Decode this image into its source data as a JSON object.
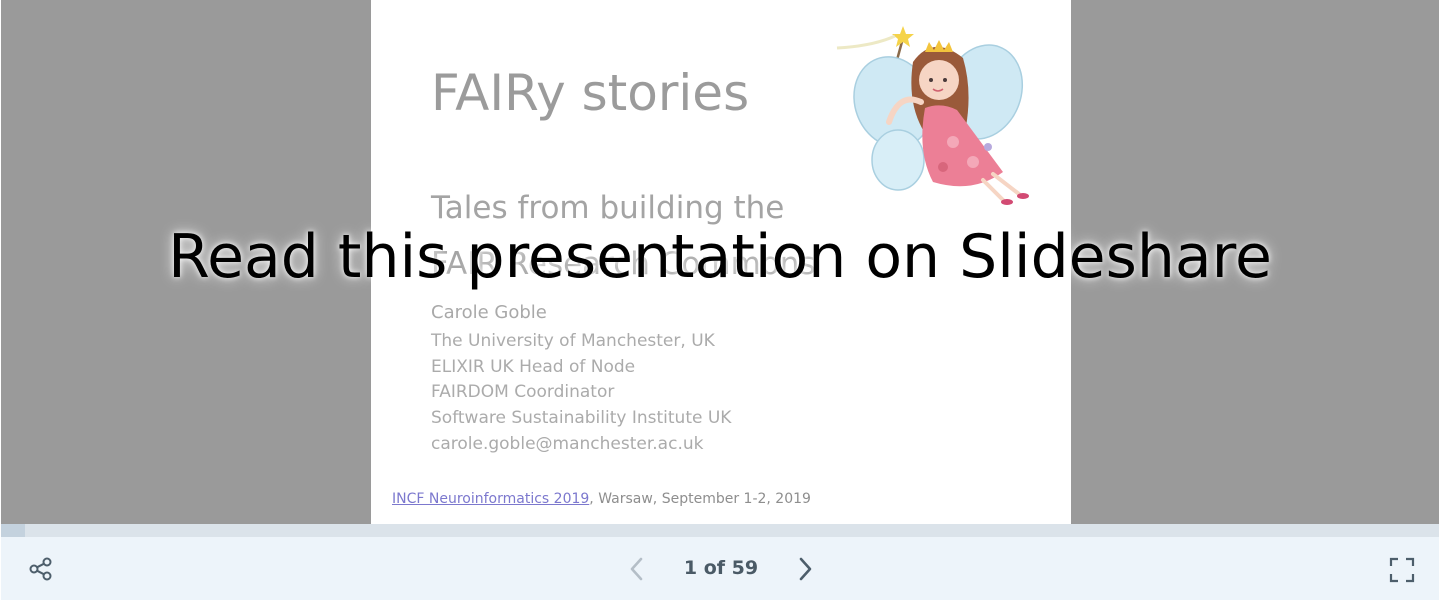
{
  "slide": {
    "title": "FAIRy stories",
    "subtitle_lines": [
      "Tales from building the",
      "FAIR Research Commons"
    ],
    "author": "Carole Goble",
    "affiliations": [
      "The University of Manchester, UK",
      "ELIXIR UK Head of Node",
      "FAIRDOM Coordinator",
      "Software Sustainability Institute UK",
      "carole.goble@manchester.ac.uk"
    ],
    "footer_link": "INCF Neuroinformatics 2019",
    "footer_rest": ", Warsaw, September 1-2, 2019",
    "image": "fairy-illustration"
  },
  "overlay": {
    "text": "Read this presentation on Slideshare"
  },
  "toolbar": {
    "share_icon": "share-icon",
    "prev_icon": "chevron-left-icon",
    "next_icon": "chevron-right-icon",
    "fullscreen_icon": "fullscreen-icon",
    "counter": "1 of 59"
  },
  "progress": {
    "current": 1,
    "total": 59
  },
  "colors": {
    "stage": "#9a9a9a",
    "toolbar": "#edf4fa",
    "link": "#7c78ce",
    "overlay_text": "#000000"
  }
}
